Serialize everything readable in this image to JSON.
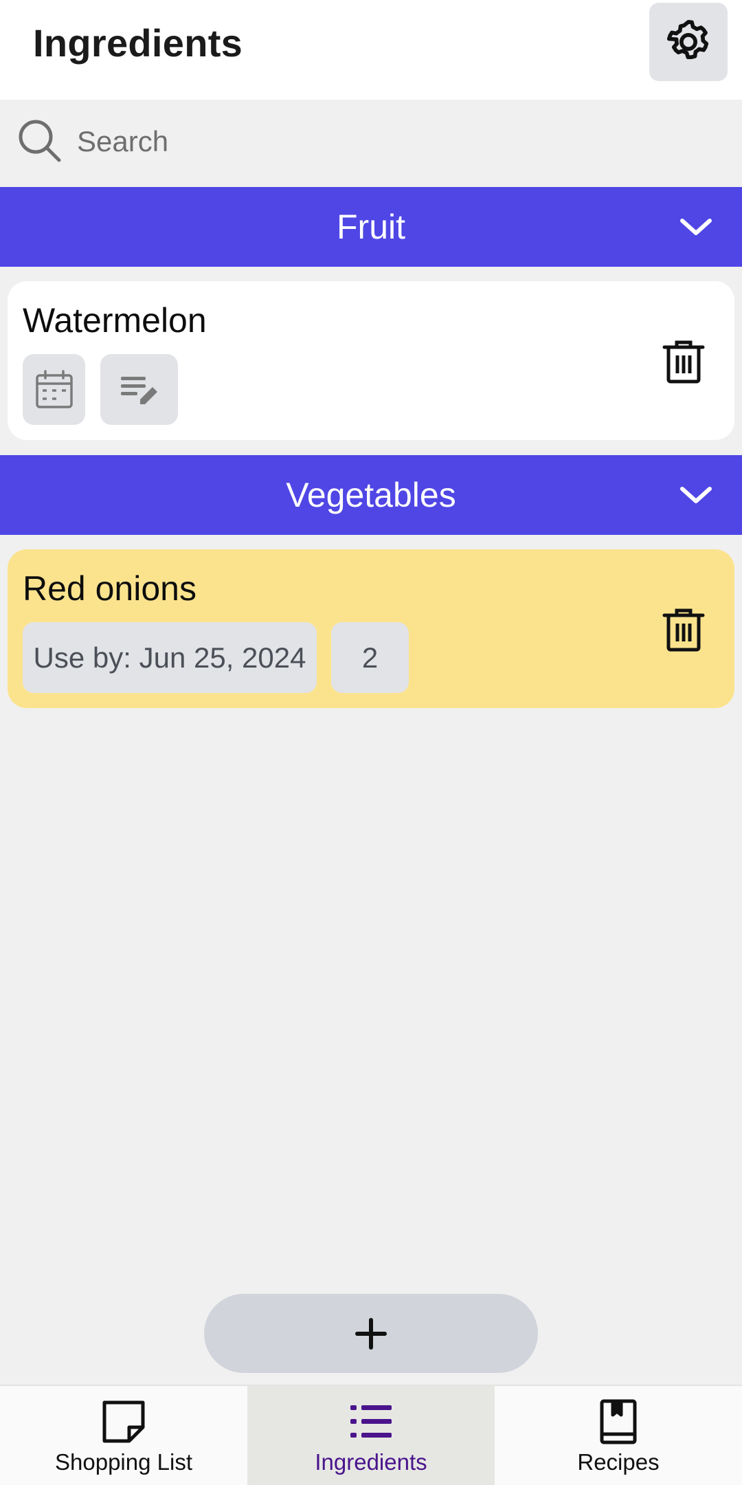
{
  "header": {
    "title": "Ingredients",
    "settings_icon": "gear-icon"
  },
  "search": {
    "placeholder": "Search",
    "value": ""
  },
  "categories": [
    {
      "name": "Fruit",
      "expanded_icon": "chevron-down-icon",
      "items": [
        {
          "name": "Watermelon",
          "chips": [
            {
              "type": "icon",
              "icon": "calendar-icon"
            },
            {
              "type": "icon",
              "icon": "note-edit-icon"
            }
          ],
          "background": "#ffffff"
        }
      ]
    },
    {
      "name": "Vegetables",
      "expanded_icon": "chevron-down-icon",
      "items": [
        {
          "name": "Red onions",
          "use_by": "Use by: Jun 25, 2024",
          "quantity": "2",
          "background": "#fbe38e"
        }
      ]
    }
  ],
  "fab": {
    "icon": "plus-icon"
  },
  "bottom_nav": [
    {
      "label": "Shopping List",
      "icon": "note-icon",
      "active": false
    },
    {
      "label": "Ingredients",
      "icon": "list-icon",
      "active": true
    },
    {
      "label": "Recipes",
      "icon": "book-icon",
      "active": false
    }
  ],
  "colors": {
    "accent": "#4f46e5",
    "active_nav_text": "#4a148c",
    "highlight_card": "#fbe38e",
    "chip_bg": "#e2e3e7",
    "background": "#f0f0f0"
  }
}
